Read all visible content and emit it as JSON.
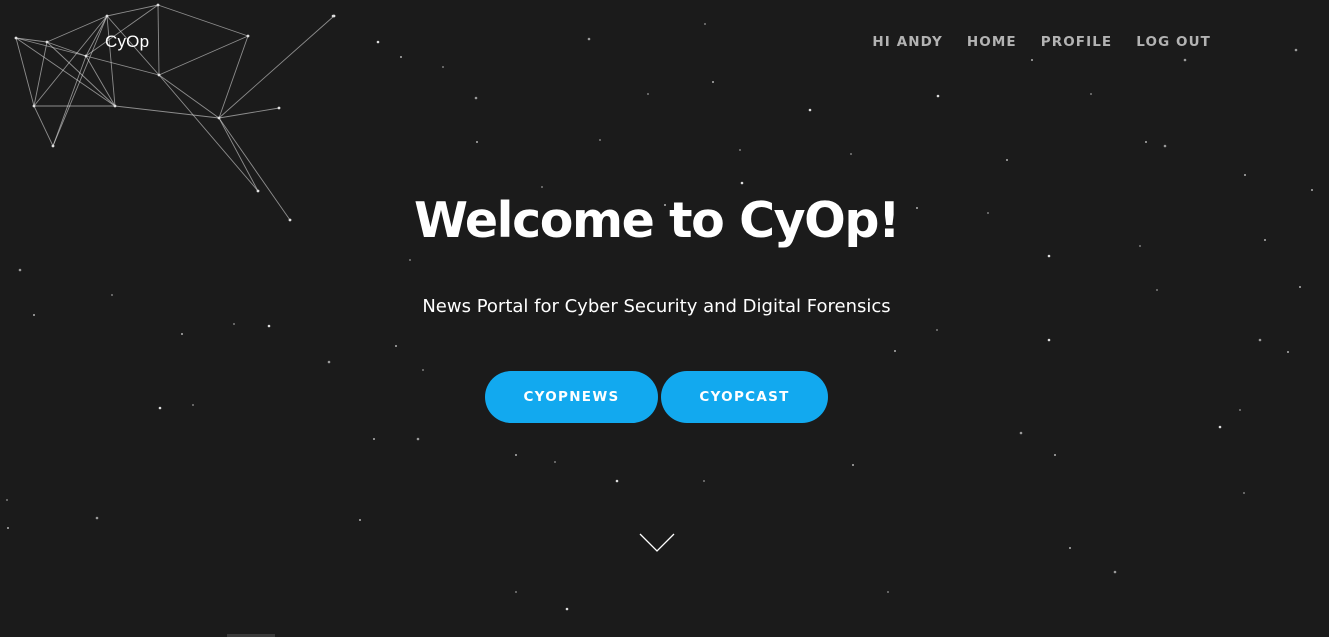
{
  "brand": {
    "name": "CyOp"
  },
  "nav": {
    "greeting": "HI ANDY",
    "home": "HOME",
    "profile": "PROFILE",
    "logout": "LOG OUT"
  },
  "hero": {
    "title": "Welcome to CyOp!",
    "subtitle": "News Portal for Cyber Security and Digital Forensics",
    "buttons": {
      "news": "CYOPNEWS",
      "cast": "CYOPCAST"
    }
  },
  "icons": {
    "scroll": "chevron-down-icon"
  },
  "colors": {
    "background": "#1b1b1b",
    "accent": "#12a9ef",
    "nav_text": "#b3b3b3",
    "text": "#ffffff"
  }
}
